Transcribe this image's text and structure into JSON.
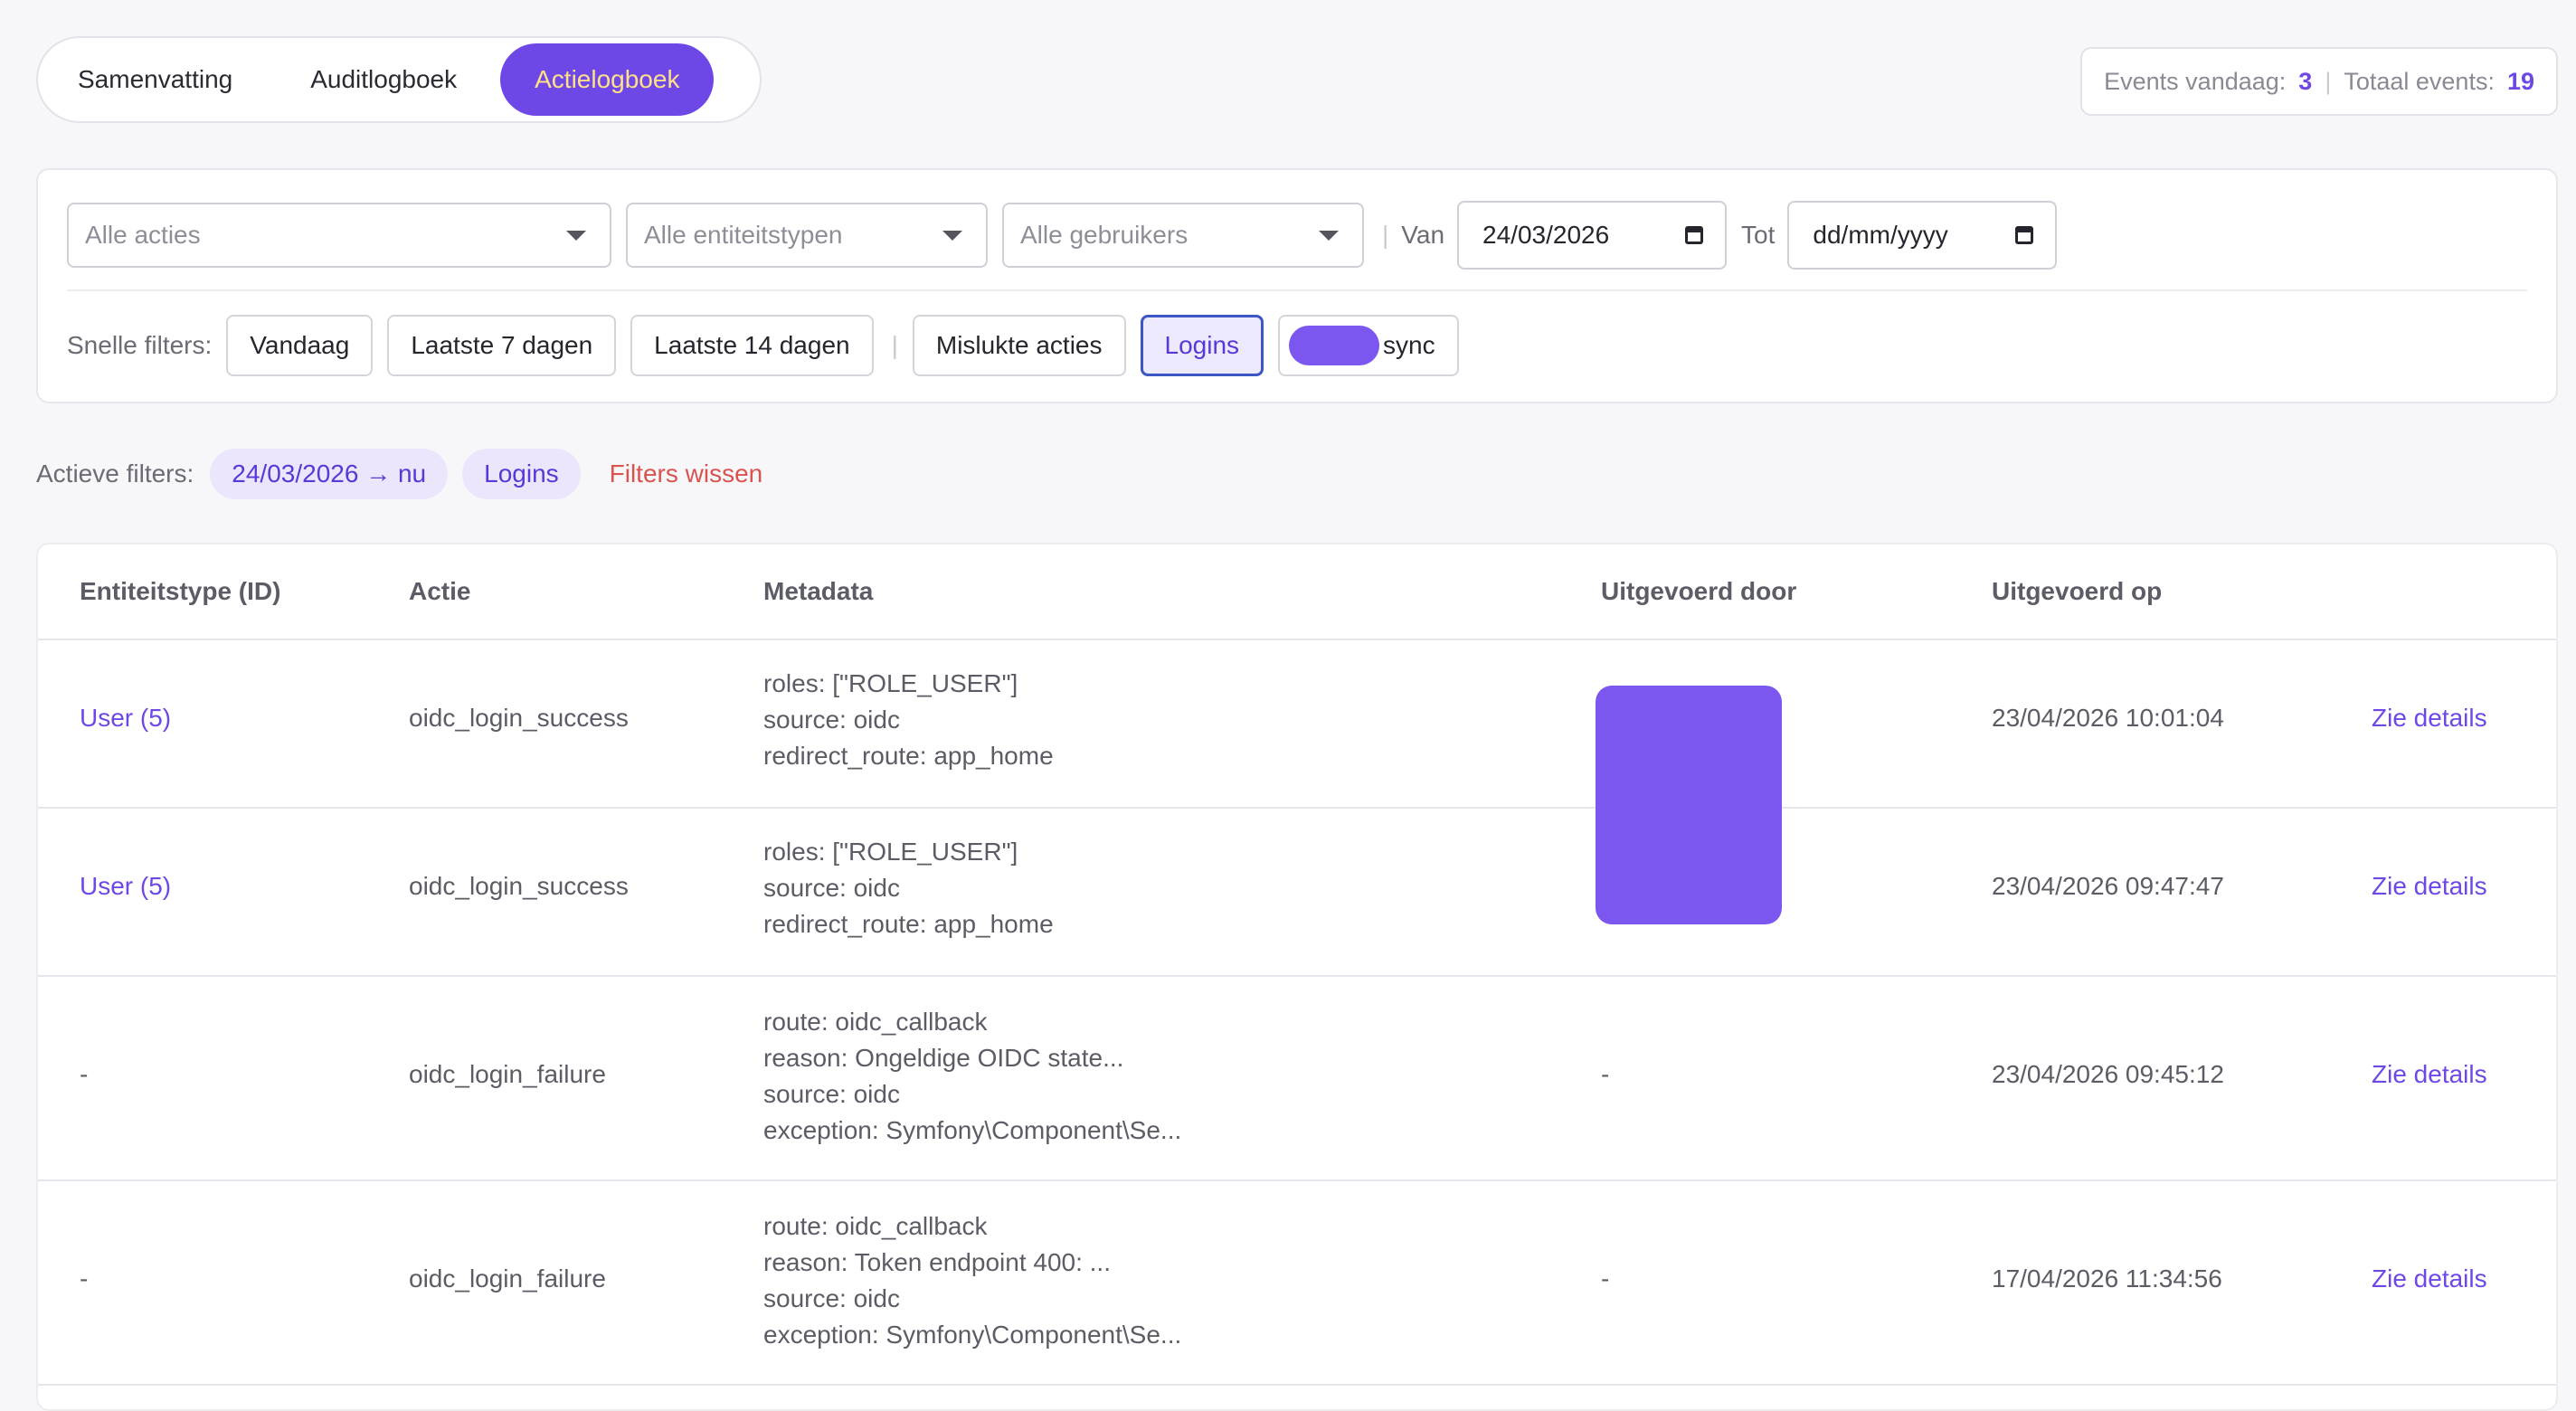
{
  "tabs": [
    {
      "label": "Samenvatting",
      "active": false
    },
    {
      "label": "Auditlogboek",
      "active": false
    },
    {
      "label": "Actielogboek",
      "active": true
    }
  ],
  "counters": {
    "today_label": "Events vandaag:",
    "today_value": "3",
    "separator": "|",
    "total_label": "Totaal events:",
    "total_value": "19"
  },
  "filters": {
    "actions_placeholder": "Alle acties",
    "entity_types_placeholder": "Alle entiteitstypen",
    "users_placeholder": "Alle gebruikers",
    "separator": "|",
    "from_label": "Van",
    "from_value": "24/03/2026",
    "to_label": "Tot",
    "to_value": "dd/mm/yyyy",
    "quick_label": "Snelle filters:",
    "quick": [
      {
        "label": "Vandaag"
      },
      {
        "label": "Laatste 7 dagen"
      },
      {
        "label": "Laatste 14 dagen"
      },
      {
        "label": "Mislukte acties"
      },
      {
        "label": "Logins",
        "active": true
      },
      {
        "label": "sync"
      }
    ]
  },
  "active_filters": {
    "label": "Actieve filters:",
    "chips": [
      "24/03/2026 → nu",
      "Logins"
    ],
    "clear_label": "Filters wissen"
  },
  "table": {
    "headers": [
      "Entiteitstype (ID)",
      "Actie",
      "Metadata",
      "Uitgevoerd door",
      "Uitgevoerd op"
    ],
    "rows": [
      {
        "entity": "User (5)",
        "action": "oidc_login_success",
        "metadata": [
          "roles: [\"ROLE_USER\"]",
          "source: oidc",
          "redirect_route: app_home"
        ],
        "performed_by": "",
        "performed_at": "23/04/2026 10:01:04",
        "details": "Zie details"
      },
      {
        "entity": "User (5)",
        "action": "oidc_login_success",
        "metadata": [
          "roles: [\"ROLE_USER\"]",
          "source: oidc",
          "redirect_route: app_home"
        ],
        "performed_by": "",
        "performed_at": "23/04/2026 09:47:47",
        "details": "Zie details"
      },
      {
        "entity": "-",
        "action": "oidc_login_failure",
        "metadata": [
          "route: oidc_callback",
          "reason: Ongeldige OIDC state...",
          "source: oidc",
          "exception: Symfony\\Component\\Se..."
        ],
        "performed_by": "-",
        "performed_at": "23/04/2026 09:45:12",
        "details": "Zie details"
      },
      {
        "entity": "-",
        "action": "oidc_login_failure",
        "metadata": [
          "route: oidc_callback",
          "reason: Token endpoint 400: ...",
          "source: oidc",
          "exception: Symfony\\Component\\Se..."
        ],
        "performed_by": "-",
        "performed_at": "17/04/2026 11:34:56",
        "details": "Zie details"
      }
    ]
  },
  "colors": {
    "accent": "#6e48e6",
    "active_tab_text": "#ffe08a",
    "danger": "#d9534f",
    "avatar_redaction": "#7b57f0"
  }
}
